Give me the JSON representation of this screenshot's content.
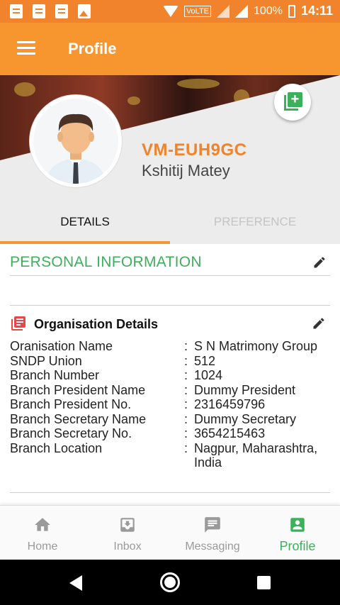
{
  "status_bar": {
    "network": "VoLTE",
    "battery": "100%",
    "time": "14:11"
  },
  "app_bar": {
    "title": "Profile",
    "menu_icon": "hamburger-menu-icon"
  },
  "profile": {
    "id": "VM-EUH9GC",
    "name": "Kshitij Matey",
    "add_photo_icon": "add-photo-icon"
  },
  "tabs": [
    {
      "label": "DETAILS",
      "active": true
    },
    {
      "label": "PREFERENCE",
      "active": false
    }
  ],
  "personal_section": {
    "title": "PERSONAL INFORMATION"
  },
  "organisation": {
    "title": "Organisation Details",
    "rows": [
      {
        "label": "Oranisation Name",
        "sep": ":",
        "value": "S N Matrimony Group"
      },
      {
        "label": "SNDP Union",
        "sep": ":",
        "value": "512"
      },
      {
        "label": "Branch Number",
        "sep": ":",
        "value": "1024"
      },
      {
        "label": "Branch President Name",
        "sep": ":",
        "value": "Dummy President"
      },
      {
        "label": "Branch President No.",
        "sep": ":",
        "value": "2316459796"
      },
      {
        "label": "Branch Secretary Name",
        "sep": ":",
        "value": "Dummy Secretary"
      },
      {
        "label": "Branch Secretary No.",
        "sep": ":",
        "value": "3654215463"
      },
      {
        "label": "Branch Location",
        "sep": ":",
        "value": "Nagpur, Maharashtra, India"
      }
    ]
  },
  "bottom_nav": [
    {
      "label": "Home",
      "icon": "home-icon",
      "active": false
    },
    {
      "label": "Inbox",
      "icon": "inbox-icon",
      "active": false
    },
    {
      "label": "Messaging",
      "icon": "message-icon",
      "active": false
    },
    {
      "label": "Profile",
      "icon": "profile-icon",
      "active": true
    }
  ],
  "colors": {
    "app_bar": "#f7952f",
    "status_bar": "#f0832b",
    "accent_green": "#3db05c",
    "profile_id": "#f0832b",
    "org_icon": "#e8474a"
  }
}
